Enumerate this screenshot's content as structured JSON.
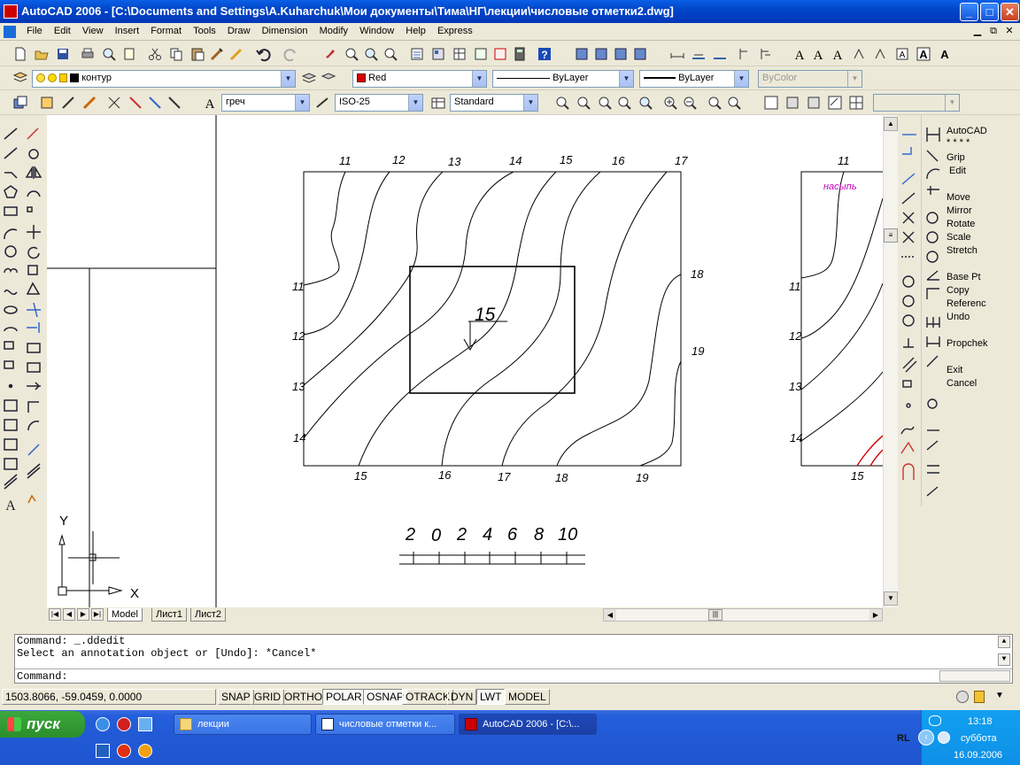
{
  "window": {
    "title": "AutoCAD 2006 - [C:\\Documents and Settings\\A.Kuharchuk\\Мои документы\\Тима\\НГ\\лекции\\числовые отметки2.dwg]",
    "min": "_",
    "max": "□",
    "close": "✕"
  },
  "menu": [
    "File",
    "Edit",
    "View",
    "Insert",
    "Format",
    "Tools",
    "Draw",
    "Dimension",
    "Modify",
    "Window",
    "Help",
    "Express"
  ],
  "layer_combo": "контур",
  "color_combo": "Red",
  "linetype_combo": "ByLayer",
  "lineweight_combo": "ByLayer",
  "plotstyle_combo": "ByColor",
  "textstyle_combo": "греч",
  "dimstyle_combo": "ISO-25",
  "tablestyle_combo": "Standard",
  "drawing": {
    "contour_labels_top": [
      "11",
      "12",
      "13",
      "14",
      "15",
      "16",
      "17"
    ],
    "contour_labels_left": [
      "11",
      "12",
      "13",
      "14"
    ],
    "contour_labels_right": [
      "18",
      "19"
    ],
    "contour_labels_bottom": [
      "15",
      "16",
      "17",
      "18",
      "19"
    ],
    "center_elevation": "15",
    "scale_numbers": [
      "2",
      "0",
      "2",
      "4",
      "6",
      "8",
      "10"
    ],
    "second_view_top": "11",
    "second_view_text": "насыпь",
    "second_view_left": [
      "11",
      "12",
      "13",
      "14"
    ],
    "second_view_bottom": "15",
    "ucs_y": "Y",
    "ucs_x": "X"
  },
  "tabs": [
    "Model",
    "Лист1",
    "Лист2"
  ],
  "grip_menu": [
    "AutoCAD",
    "* * * *",
    "Grip",
    "Edit",
    "Move",
    "Mirror",
    "Rotate",
    "Scale",
    "Stretch",
    "Base Pt",
    "Copy",
    "Referenc",
    "Undo",
    "Propchek",
    "Exit",
    "Cancel"
  ],
  "command": {
    "line1": "Command: _.ddedit",
    "line2": "Select an annotation object or [Undo]: *Cancel*",
    "prompt": "Command:"
  },
  "status": {
    "coords": "1503.8066, -59.0459, 0.0000",
    "buttons": [
      "SNAP",
      "GRID",
      "ORTHO",
      "POLAR",
      "OSNAP",
      "OTRACK",
      "DYN",
      "LWT",
      "MODEL"
    ]
  },
  "taskbar": {
    "start": "пуск",
    "items": [
      "лекции",
      "числовые отметки к...",
      "AutoCAD 2006 - [C:\\..."
    ],
    "lang": "RL",
    "time": "13:18",
    "day": "суббота",
    "date": "16.09.2006"
  },
  "colors": {
    "accent": "#0a5fe8",
    "contour_red": "#d40000",
    "annotation_magenta": "#c000c0",
    "start_green": "#3ca83c"
  }
}
